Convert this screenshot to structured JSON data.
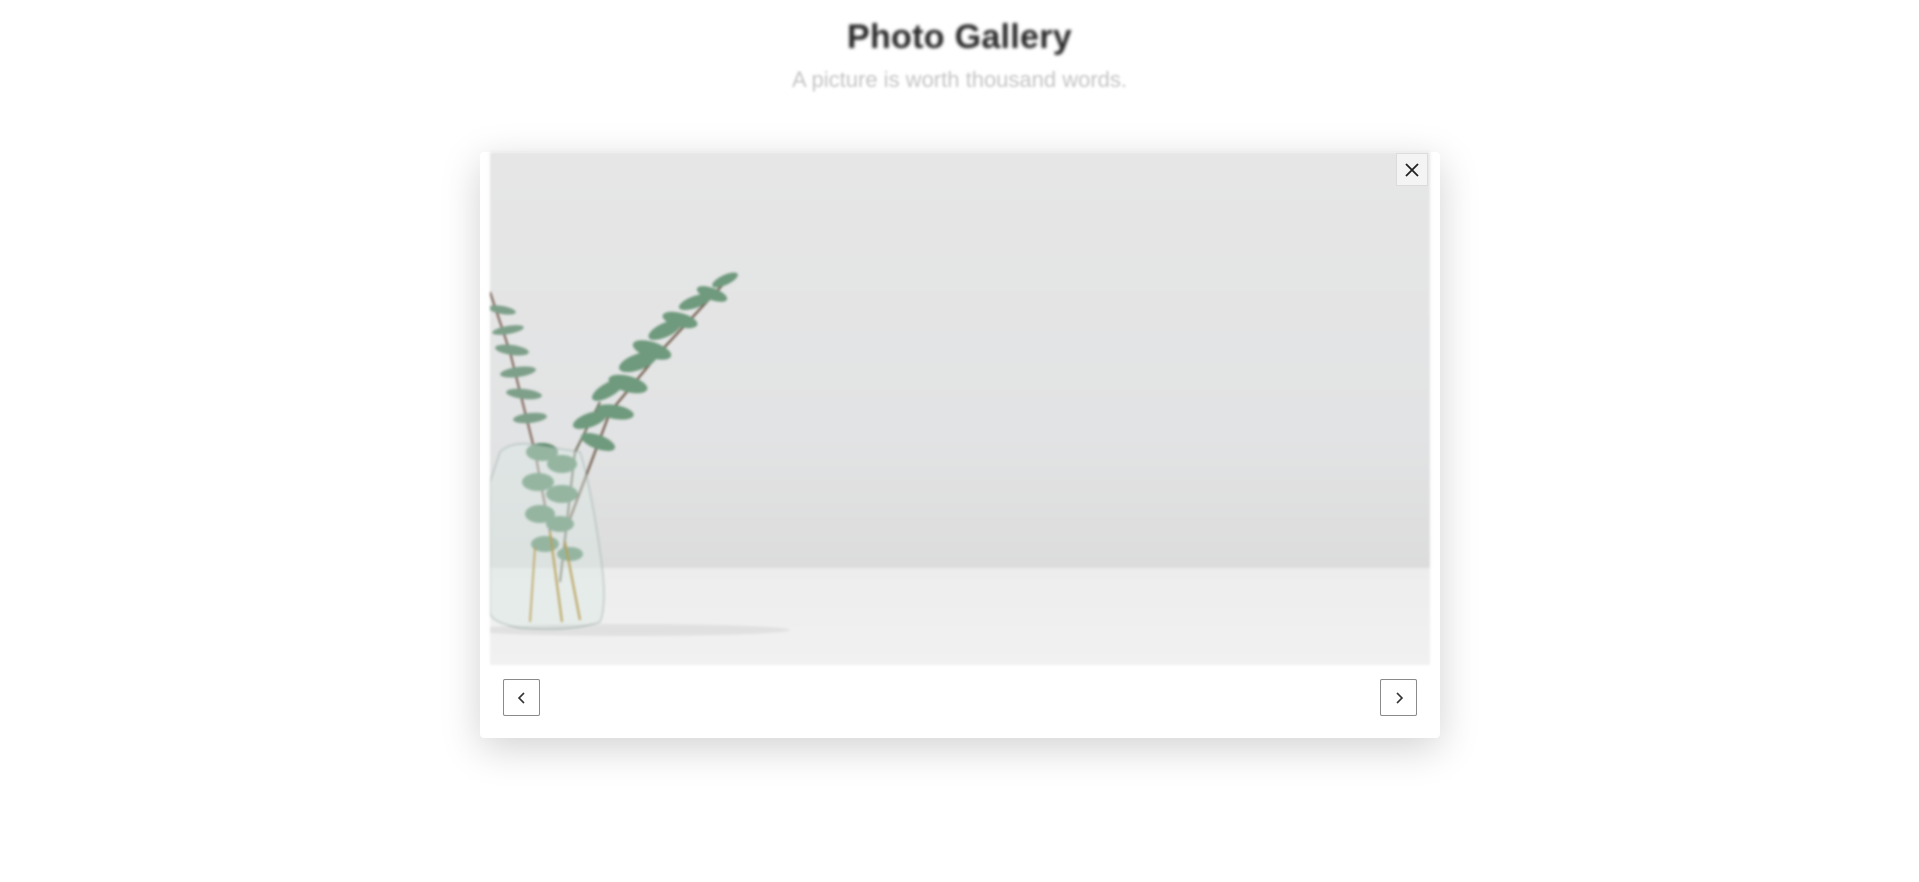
{
  "header": {
    "title": "Photo Gallery",
    "subtitle": "A picture is worth thousand words."
  },
  "lightbox": {
    "photo": {
      "subject": "eucalyptus-branch-in-glass-vase"
    },
    "controls": {
      "close_icon": "close-icon",
      "prev_icon": "chevron-left-icon",
      "next_icon": "chevron-right-icon"
    }
  },
  "colors": {
    "background": "#ffffff",
    "title": "#2a2a2a",
    "subtitle": "#c4c4c4",
    "photo_wall": "#e4e4e4",
    "photo_table": "#f0f0f0",
    "leaf": "#6f9a7d"
  }
}
